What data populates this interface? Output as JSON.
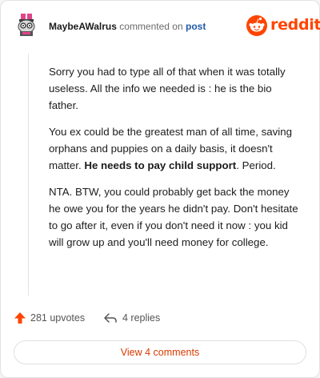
{
  "header": {
    "username": "MaybeAWalrus",
    "commented_on": "commented on",
    "post_link": "post",
    "logo_text": "reddit"
  },
  "icons": {
    "avatar": "snoo-avatar",
    "logo": "reddit-snoo-icon",
    "upvote": "upvote-arrow-icon",
    "reply": "reply-arrow-icon"
  },
  "colors": {
    "brand": "#ff4500",
    "link": "#1f5aa8",
    "view_button_text": "#d93a00"
  },
  "comment": {
    "p1": "Sorry you had to type all of that when it was totally useless. All the info we needed is : he is the bio father.",
    "p2_before": "You ex could be the greatest man of all time, saving orphans and puppies on a daily basis, it doesn't matter. ",
    "p2_bold": "He needs to pay child support",
    "p2_after": ". Period.",
    "p3": "NTA. BTW, you could probably get back the money he owe you for the years he didn't pay. Don't hesitate to go after it, even if you don't need it now : you kid will grow up and you'll need money for college."
  },
  "actions": {
    "upvotes": "281 upvotes",
    "replies": "4 replies"
  },
  "view_button": "View 4 comments"
}
